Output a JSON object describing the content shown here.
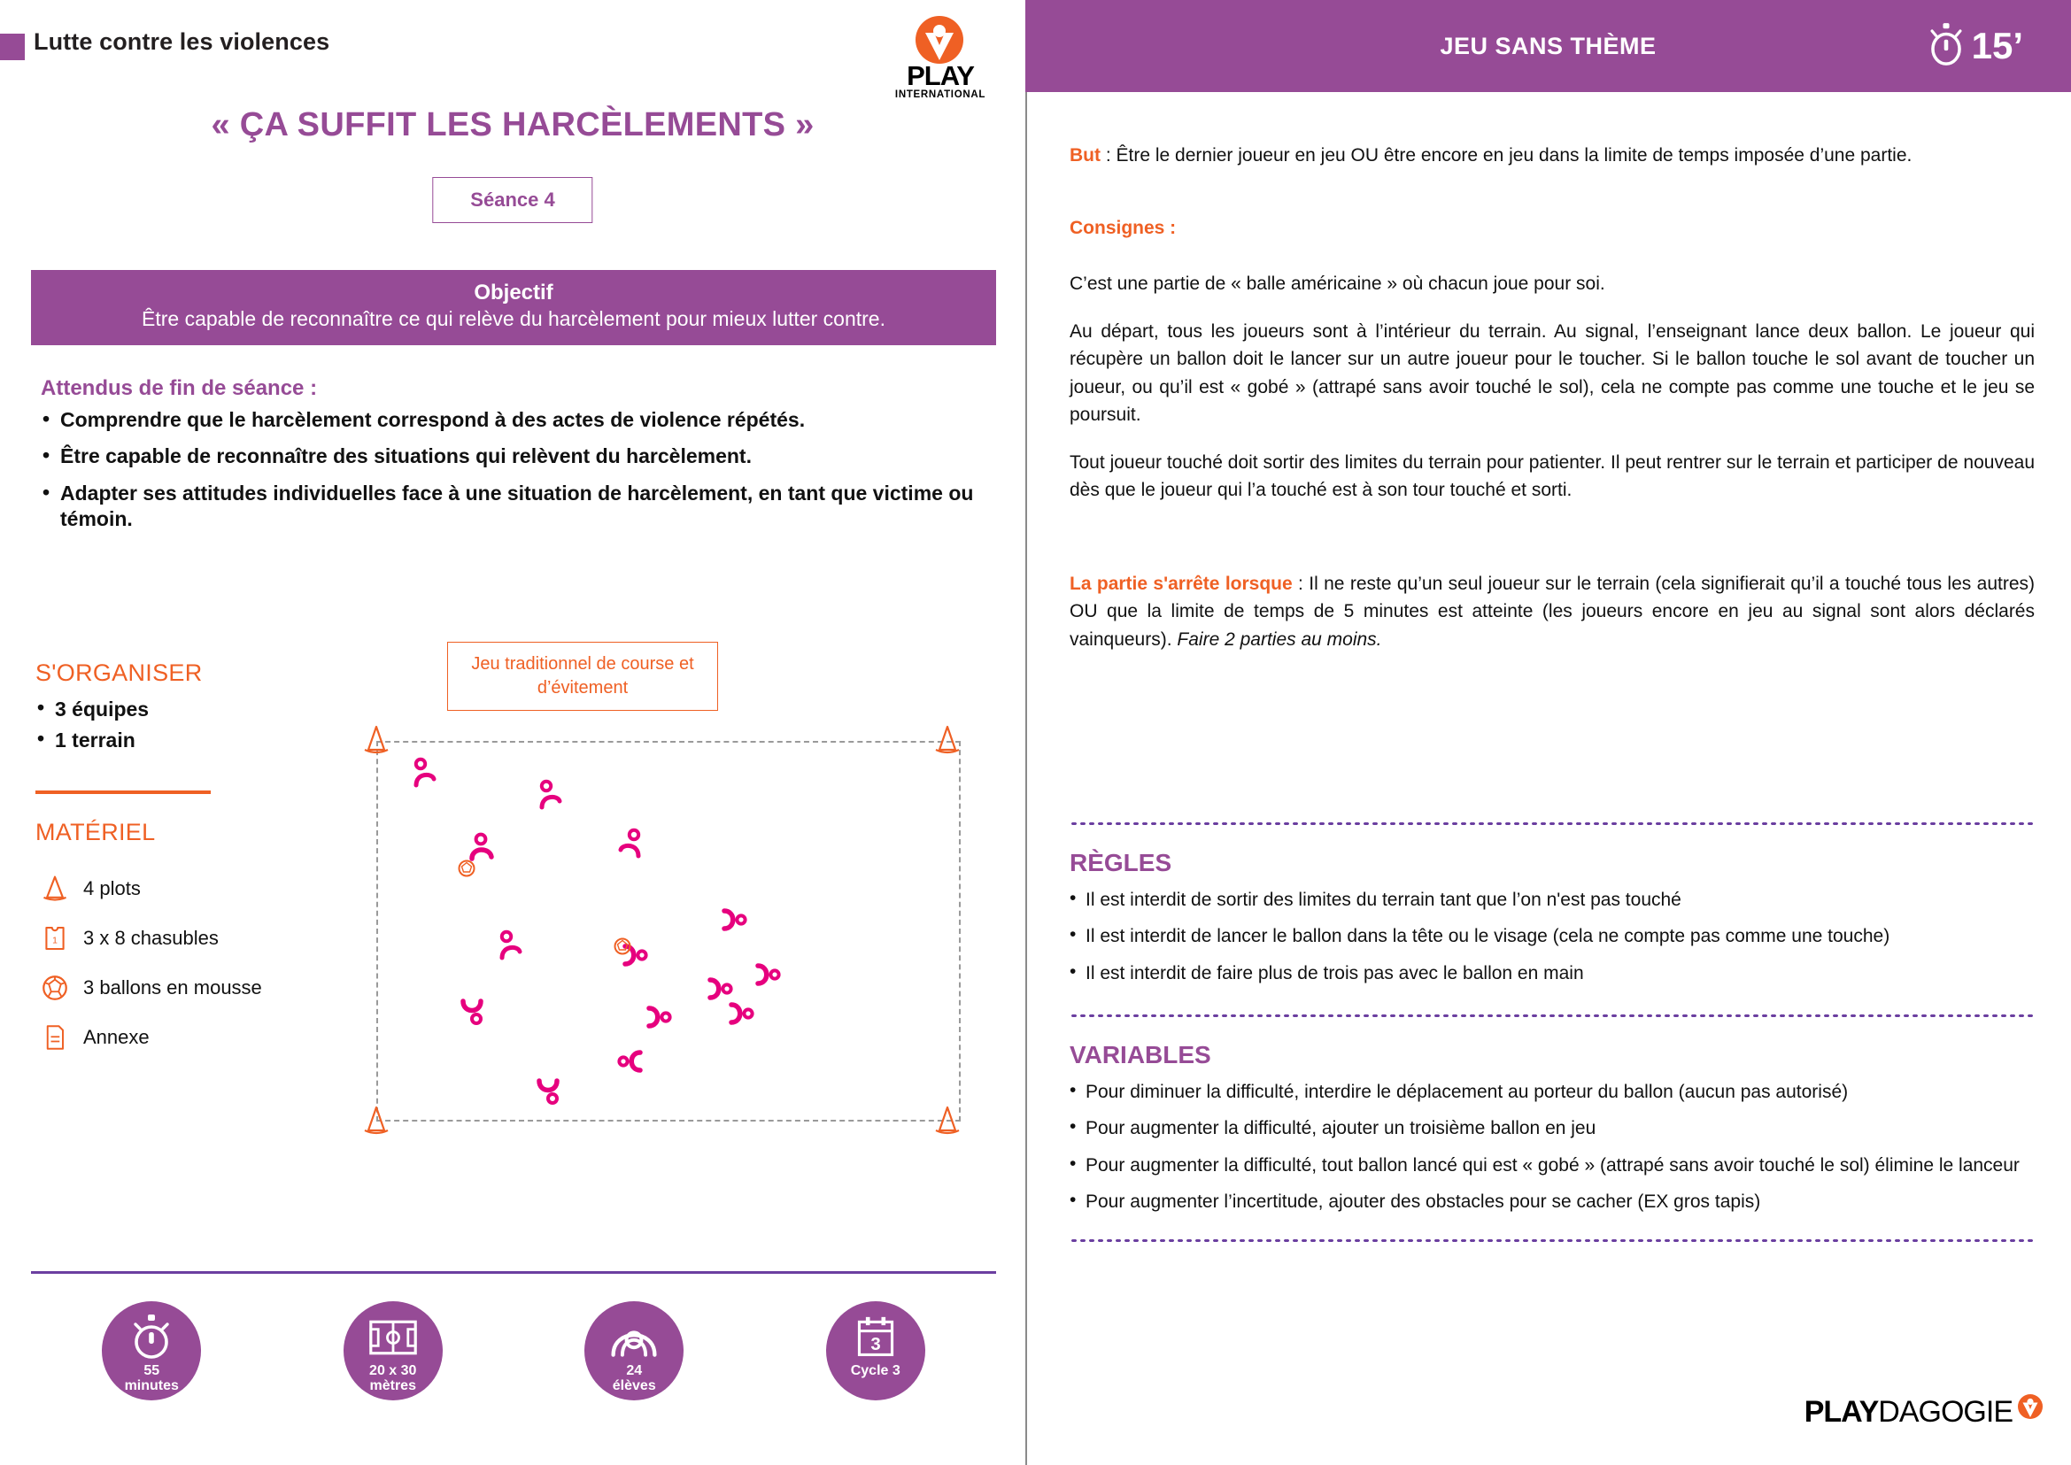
{
  "left": {
    "kicker": "Lutte contre les violences",
    "logo": {
      "word_bold": "PLAY",
      "sub": "INTERNATIONAL"
    },
    "title": "« ÇA SUFFIT LES HARCÈLEMENTS »",
    "seance": "Séance 4",
    "objectif": {
      "heading": "Objectif",
      "text": "Être capable de reconnaître ce qui relève du harcèlement pour mieux lutter contre."
    },
    "attendus": {
      "heading": "Attendus de fin de séance :",
      "items": [
        "Comprendre que le harcèlement correspond à des actes de violence répétés.",
        "Être capable de reconnaître des situations qui relèvent du harcèlement.",
        "Adapter ses attitudes individuelles face à une situation de harcèlement, en tant que victime ou témoin."
      ]
    },
    "organiser": {
      "heading": "S'ORGANISER",
      "items": [
        "3 équipes",
        "1 terrain"
      ]
    },
    "materiel": {
      "heading": "MATÉRIEL",
      "items": [
        {
          "icon": "cone-icon",
          "label": "4 plots"
        },
        {
          "icon": "jersey-icon",
          "label": "3 x 8 chasubles"
        },
        {
          "icon": "ball-icon",
          "label": "3 ballons en mousse"
        },
        {
          "icon": "annexe-document-icon",
          "label": "Annexe"
        }
      ]
    },
    "diagram": {
      "caption": "Jeu traditionnel de course et d’évitement",
      "cones": 4,
      "players": 15,
      "balls": 2
    },
    "badges": [
      {
        "icon": "stopwatch-icon",
        "line1": "55",
        "line2": "minutes"
      },
      {
        "icon": "field-icon",
        "line1": "20 x 30",
        "line2": "mètres"
      },
      {
        "icon": "students-icon",
        "line1": "24",
        "line2": "élèves"
      },
      {
        "icon": "calendar-icon",
        "line1": "Cycle 3",
        "line2": "",
        "calendar_number": "3"
      }
    ]
  },
  "right": {
    "header": {
      "title": "JEU SANS THÈME",
      "duration": "15’",
      "icon": "stopwatch-icon"
    },
    "but": {
      "label": "But",
      "separator": " : ",
      "text": "Être le dernier joueur en jeu OU être encore en jeu dans la limite de temps imposée d’une partie."
    },
    "consignes": {
      "label": "Consignes :",
      "paragraphs": [
        "C’est une partie de « balle américaine » où chacun joue pour soi.",
        "Au départ, tous les joueurs sont à l’intérieur du terrain. Au signal, l’enseignant lance deux ballon. Le joueur qui récupère un ballon doit le lancer sur un autre joueur pour le toucher. Si le ballon touche le sol avant de toucher un joueur, ou qu’il est « gobé » (attrapé sans avoir touché le sol), cela ne compte pas comme une touche et le jeu se poursuit.",
        "Tout joueur touché doit sortir des limites du terrain pour patienter. Il peut rentrer sur le terrain et participer de nouveau dès que le joueur qui l’a touché est à son tour touché et sorti."
      ]
    },
    "fin": {
      "label": "La partie s'arrête lorsque",
      "separator": " : ",
      "text": "Il ne reste qu’un seul joueur sur le terrain (cela signifierait qu’il a touché tous les autres) OU que la limite de temps de 5 minutes est atteinte (les joueurs encore en jeu au signal sont alors déclarés vainqueurs). ",
      "italic": "Faire 2 parties au moins."
    },
    "regles": {
      "heading": "RÈGLES",
      "items": [
        "Il est interdit de sortir des limites du terrain tant que l’on n'est pas touché",
        "Il est interdit de lancer le ballon dans la tête ou le visage (cela ne compte pas comme une touche)",
        "Il est interdit de faire plus de trois pas avec le ballon en main"
      ]
    },
    "variables": {
      "heading": "VARIABLES",
      "items": [
        "Pour diminuer la difficulté, interdire le déplacement au porteur du ballon (aucun pas autorisé)",
        "Pour augmenter la difficulté, ajouter un troisième ballon en jeu",
        "Pour augmenter la difficulté, tout ballon lancé qui est « gobé » (attrapé sans avoir touché le sol) élimine le lanceur",
        "Pour augmenter l’incertitude, ajouter des obstacles pour se cacher (EX gros tapis)"
      ]
    },
    "footer_logo": {
      "bold": "PLAY",
      "light": "DAGOGIE"
    }
  },
  "colors": {
    "purple": "#964b96",
    "deep_purple": "#6b3fa0",
    "orange": "#ef6024",
    "pink": "#e6007e",
    "grey_dash": "#9a9a9a"
  }
}
